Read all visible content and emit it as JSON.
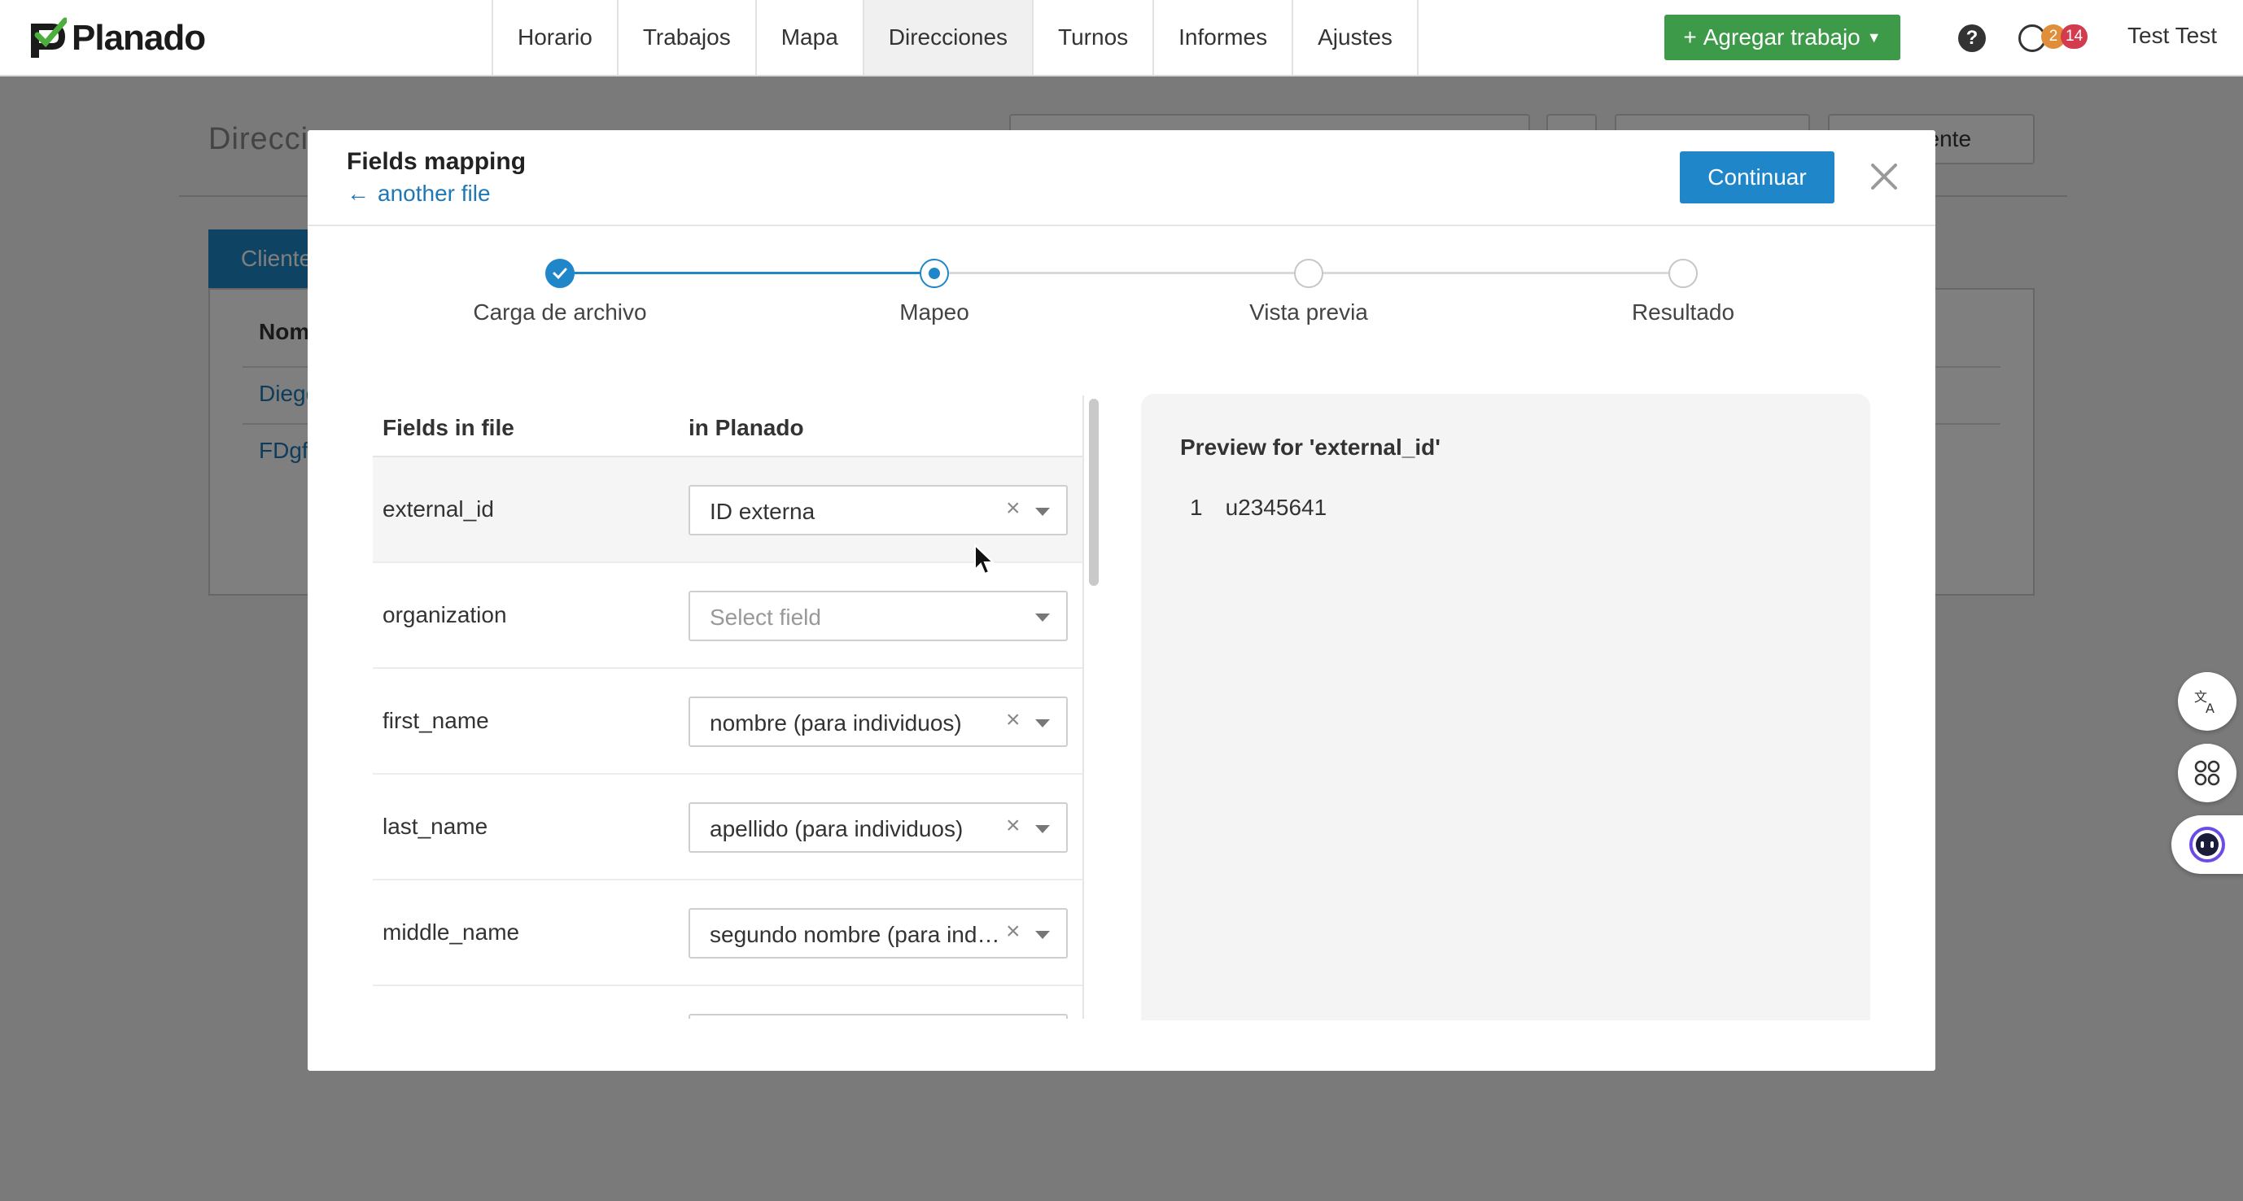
{
  "nav": {
    "logo": "Planado",
    "items": [
      "Horario",
      "Trabajos",
      "Mapa",
      "Direcciones",
      "Turnos",
      "Informes",
      "Ajustes"
    ],
    "active": "Direcciones",
    "add_job": "Agregar trabajo",
    "help": "?",
    "notif_counts": [
      "2",
      "14"
    ],
    "user": "Test Test"
  },
  "background": {
    "page_title": "Direcci",
    "add_client": "r cliente",
    "tab": "Cliente",
    "column": "Nom",
    "rows": [
      "Diego",
      "FDgf"
    ]
  },
  "modal": {
    "title": "Fields mapping",
    "back_link": "another file",
    "continue": "Continuar",
    "steps": [
      {
        "label": "Carga de archivo",
        "state": "done"
      },
      {
        "label": "Mapeo",
        "state": "current"
      },
      {
        "label": "Vista previa",
        "state": "todo"
      },
      {
        "label": "Resultado",
        "state": "todo"
      }
    ],
    "table": {
      "col_file": "Fields in file",
      "col_planado": "in Planado",
      "rows": [
        {
          "field": "external_id",
          "value": "ID externa"
        },
        {
          "field": "organization",
          "placeholder": "Select field"
        },
        {
          "field": "first_name",
          "value": "nombre (para individuos)"
        },
        {
          "field": "last_name",
          "value": "apellido (para individuos)"
        },
        {
          "field": "middle_name",
          "value": "segundo nombre (para individuos)"
        }
      ]
    },
    "preview": {
      "title": "Preview for 'external_id'",
      "rows": [
        {
          "index": "1",
          "value": "u2345641"
        }
      ]
    }
  },
  "colors": {
    "primary": "#1f86c9",
    "success": "#3c9a49",
    "badge_orange": "#e08e3a",
    "badge_red": "#d33b4f"
  }
}
